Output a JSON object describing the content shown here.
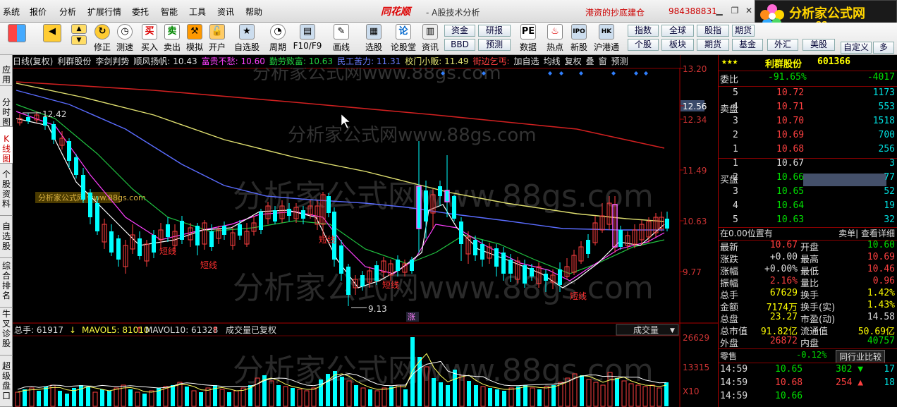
{
  "menu": [
    "系统",
    "报价",
    "分析",
    "扩展行情",
    "委托",
    "智能",
    "工具",
    "资讯",
    "帮助"
  ],
  "app": {
    "logo": "同花顺",
    "subtitle": "- A股技术分析",
    "ticker": "港资的抄底建仓",
    "phone": "984388831"
  },
  "brand": {
    "title": "分析家公式网",
    "url": "www.88gs.com"
  },
  "toolbar": {
    "buttons": [
      "修正",
      "测速",
      "买入",
      "卖出",
      "模拟",
      "开户",
      "自选股",
      "周期",
      "F10/F9",
      "画线",
      "选股",
      "论股堂",
      "资讯",
      "数据",
      "热点",
      "新股",
      "沪港通"
    ],
    "tabs": [
      "资金",
      "BBD",
      "研报",
      "预测",
      "指数",
      "全球",
      "股指",
      "期货",
      "个股",
      "板块",
      "期货",
      "基金",
      "外汇",
      "美股",
      "自定义",
      "多"
    ]
  },
  "left_nav": [
    "应用",
    "分时图",
    "K线图",
    "个股资料",
    "自选股",
    "综合排名",
    "牛叉诊股",
    "超级盘口"
  ],
  "info_bar": {
    "period": "日线(复权)",
    "stock": "利群股份",
    "i1": "李剑判势",
    "i2": "顺风扬帆: 10.43",
    "i3": "富贵不愁: 10.60",
    "i4": "勤劳致富: 10.63",
    "i5": "民工苦力: 11.31",
    "i6": "校门小贩: 11.49",
    "i7": "街边乞丐:",
    "add": "加自选",
    "ma": "均线",
    "fq": "复权",
    "die": "叠",
    "win": "窗",
    "pred": "预测"
  },
  "price_axis": [
    "13.20",
    "12.56",
    "12.34",
    "11.49",
    "10.63",
    "9.77"
  ],
  "annotations": {
    "high": "12.42",
    "low": "9.13",
    "zhang": "涨",
    "short": "短线"
  },
  "watermark": {
    "text": "分析家公式网www.88gs.com",
    "small": "分析家公式网 www.88gs.com"
  },
  "volume_bar": {
    "total": "总手: 61917",
    "mavol5": "MAVOL5: 81010",
    "mavol10": "MAVOL10: 61328",
    "note": "成交量已复权",
    "select": "成交量"
  },
  "volume_axis": [
    "26629",
    "13315",
    "X10"
  ],
  "quote": {
    "stars": "★★★",
    "name": "利群股份",
    "code": "601366",
    "weibi_label": "委比",
    "weibi": "-91.65%",
    "weicha": "-4017",
    "sell_label": "卖盘",
    "buy_label": "买盘",
    "sell": [
      {
        "n": "5",
        "p": "10.72",
        "v": "1173"
      },
      {
        "n": "4",
        "p": "10.71",
        "v": "553"
      },
      {
        "n": "3",
        "p": "10.70",
        "v": "1518"
      },
      {
        "n": "2",
        "p": "10.69",
        "v": "700"
      },
      {
        "n": "1",
        "p": "10.68",
        "v": "256"
      }
    ],
    "buy": [
      {
        "n": "1",
        "p": "10.67",
        "v": "3"
      },
      {
        "n": "2",
        "p": "10.66",
        "v": "77"
      },
      {
        "n": "3",
        "p": "10.65",
        "v": "52"
      },
      {
        "n": "4",
        "p": "10.64",
        "v": "19"
      },
      {
        "n": "5",
        "p": "10.63",
        "v": "32"
      }
    ],
    "position": "在0.00位置有",
    "sellone": "卖单| 查看详细",
    "stats": [
      [
        "最新",
        "10.67",
        "开盘",
        "10.60"
      ],
      [
        "涨跌",
        "+0.00",
        "最高",
        "10.69"
      ],
      [
        "涨幅",
        "+0.00%",
        "最低",
        "10.46"
      ],
      [
        "振幅",
        "2.16%",
        "量比",
        "0.96"
      ],
      [
        "总手",
        "67629",
        "换手",
        "1.42%"
      ],
      [
        "金额",
        "7174万",
        "换手(实)",
        "1.43%"
      ],
      [
        "总盘",
        "23.27",
        "市盈(动)",
        "14.58"
      ],
      [
        "总市值",
        "91.82亿",
        "流通值",
        "50.69亿"
      ],
      [
        "外盘",
        "26872",
        "内盘",
        "40757"
      ]
    ],
    "zero_label": "零售",
    "zero_val": "-0.12%",
    "compare": "同行业比较",
    "ticks": [
      {
        "t": "14:59",
        "p": "10.65",
        "v": "302",
        "d": "17"
      },
      {
        "t": "14:59",
        "p": "10.68",
        "v": "254",
        "d": "18"
      },
      {
        "t": "14:59",
        "p": "10.66",
        "v": "",
        "d": ""
      }
    ]
  },
  "colors": {
    "up": "#ff4040",
    "down": "#00ffff",
    "ma_yellow": "#e0e070",
    "ma_blue": "#5a6cff",
    "ma_green": "#20c040",
    "ma_pink": "#ff40ff",
    "ma_red": "#d02020",
    "white": "#ffffff"
  }
}
